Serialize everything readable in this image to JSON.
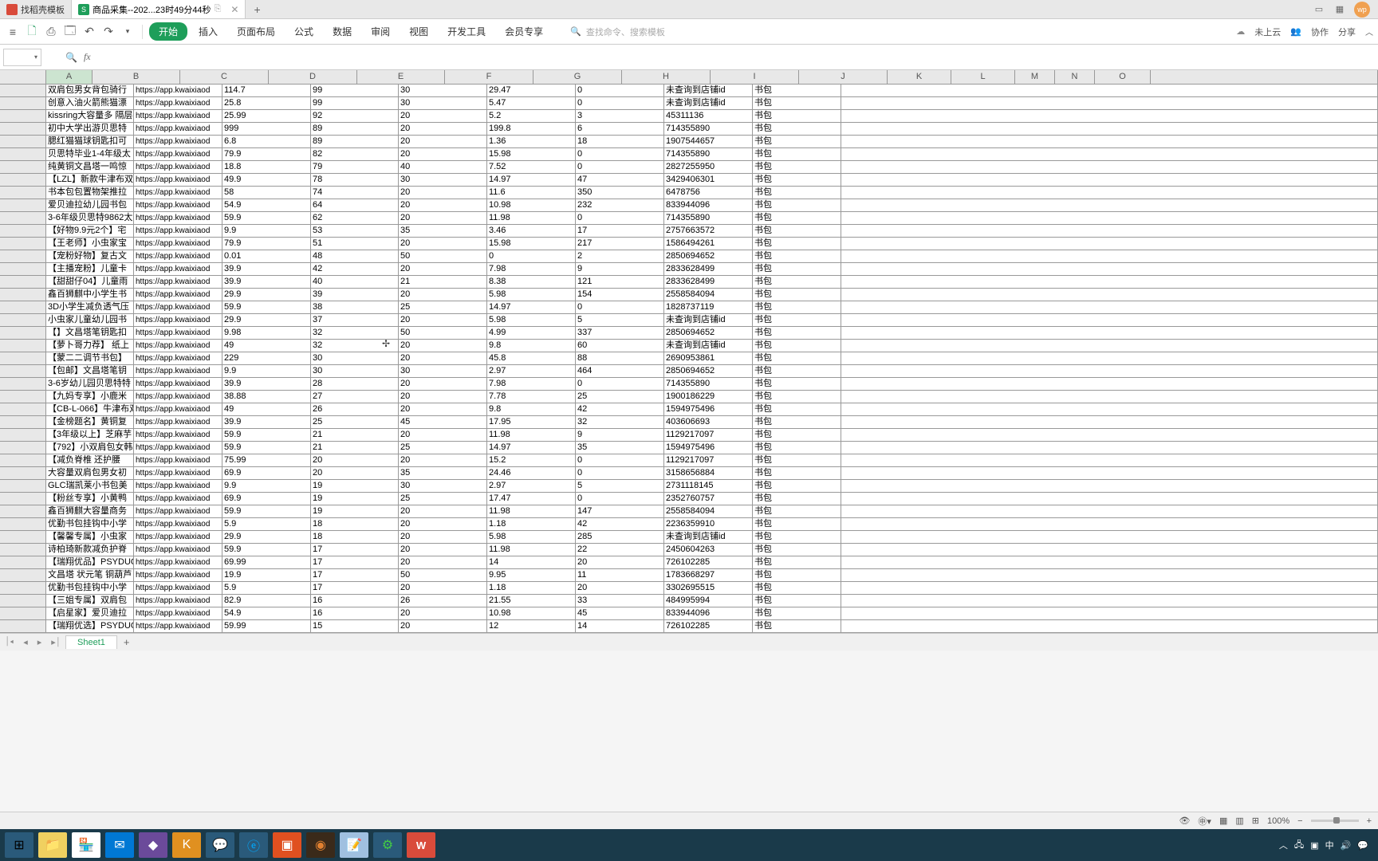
{
  "tabs": {
    "inactive": "找稻壳模板",
    "active": "商品采集--202...23时49分44秒",
    "active_suffix": "✕"
  },
  "titlebar_right": {
    "user": "wp"
  },
  "menu": {
    "start": "开始",
    "insert": "插入",
    "layout": "页面布局",
    "formula": "公式",
    "data": "数据",
    "review": "审阅",
    "view": "视图",
    "dev": "开发工具",
    "member": "会员专享"
  },
  "search_placeholder": "查找命令、搜索模板",
  "ribbon_right": {
    "cloud": "未上云",
    "collab": "协作",
    "share": "分享"
  },
  "formula": {
    "fx": "fx"
  },
  "columns": [
    "A",
    "B",
    "C",
    "D",
    "E",
    "F",
    "G",
    "H",
    "I",
    "J",
    "K",
    "L",
    "M",
    "N",
    "O"
  ],
  "col_widths": {
    "A": 58,
    "B": 110,
    "C": 111,
    "D": 111,
    "E": 110,
    "F": 111,
    "G": 111,
    "H": 111,
    "I": 111,
    "J": 111,
    "K": 80,
    "L": 80,
    "M": 50,
    "N": 50,
    "O": 70
  },
  "rows": [
    {
      "b": "双肩包男女背包骑行",
      "c": "https://app.kwaixiaod",
      "d": "114.7",
      "e": "99",
      "f": "30",
      "g": "29.47",
      "h": "0",
      "i": "未查询到店铺id",
      "j": "书包"
    },
    {
      "b": "创意入油火箭熊猫漂",
      "c": "https://app.kwaixiaod",
      "d": "25.8",
      "e": "99",
      "f": "30",
      "g": "5.47",
      "h": "0",
      "i": "未查询到店铺id",
      "j": "书包"
    },
    {
      "b": "kissring大容量多 隔层",
      "c": "https://app.kwaixiaod",
      "d": "25.99",
      "e": "92",
      "f": "20",
      "g": "5.2",
      "h": "3",
      "i": "45311136",
      "j": "书包"
    },
    {
      "b": "初中大学出游贝思特",
      "c": "https://app.kwaixiaod",
      "d": "999",
      "e": "89",
      "f": "20",
      "g": "199.8",
      "h": "6",
      "i": "714355890",
      "j": "书包"
    },
    {
      "b": "腮红猫猫球钥匙扣可",
      "c": "https://app.kwaixiaod",
      "d": "6.8",
      "e": "89",
      "f": "20",
      "g": "1.36",
      "h": "18",
      "i": "1907544657",
      "j": "书包"
    },
    {
      "b": "贝思特毕业1-4年级太",
      "c": "https://app.kwaixiaod",
      "d": "79.9",
      "e": "82",
      "f": "20",
      "g": "15.98",
      "h": "0",
      "i": "714355890",
      "j": "书包"
    },
    {
      "b": "纯黄铜文昌塔一鸣惊",
      "c": "https://app.kwaixiaod",
      "d": "18.8",
      "e": "79",
      "f": "40",
      "g": "7.52",
      "h": "0",
      "i": "2827255950",
      "j": "书包"
    },
    {
      "b": "【LZL】新款牛津布双",
      "c": "https://app.kwaixiaod",
      "d": "49.9",
      "e": "78",
      "f": "30",
      "g": "14.97",
      "h": "47",
      "i": "3429406301",
      "j": "书包"
    },
    {
      "b": "书本包包置物架推拉",
      "c": "https://app.kwaixiaod",
      "d": "58",
      "e": "74",
      "f": "20",
      "g": "11.6",
      "h": "350",
      "i": "6478756",
      "j": "书包"
    },
    {
      "b": "爱贝迪拉幼儿园书包",
      "c": "https://app.kwaixiaod",
      "d": "54.9",
      "e": "64",
      "f": "20",
      "g": "10.98",
      "h": "232",
      "i": "833944096",
      "j": "书包"
    },
    {
      "b": "3-6年级贝思特9862太",
      "c": "https://app.kwaixiaod",
      "d": "59.9",
      "e": "62",
      "f": "20",
      "g": "11.98",
      "h": "0",
      "i": "714355890",
      "j": "书包"
    },
    {
      "b": "【好物9.9元2个】宅",
      "c": "https://app.kwaixiaod",
      "d": "9.9",
      "e": "53",
      "f": "35",
      "g": "3.46",
      "h": "17",
      "i": "2757663572",
      "j": "书包"
    },
    {
      "b": "【王老师】小虫家宝",
      "c": "https://app.kwaixiaod",
      "d": "79.9",
      "e": "51",
      "f": "20",
      "g": "15.98",
      "h": "217",
      "i": "1586494261",
      "j": "书包"
    },
    {
      "b": "【宠粉好物】复古文",
      "c": "https://app.kwaixiaod",
      "d": "0.01",
      "e": "48",
      "f": "50",
      "g": "0",
      "h": "2",
      "i": "2850694652",
      "j": "书包"
    },
    {
      "b": "【主播宠粉】儿童卡",
      "c": "https://app.kwaixiaod",
      "d": "39.9",
      "e": "42",
      "f": "20",
      "g": "7.98",
      "h": "9",
      "i": "2833628499",
      "j": "书包"
    },
    {
      "b": "【甜甜仔04】儿童雨",
      "c": "https://app.kwaixiaod",
      "d": "39.9",
      "e": "40",
      "f": "21",
      "g": "8.38",
      "h": "121",
      "i": "2833628499",
      "j": "书包"
    },
    {
      "b": "鑫百狮麒中小学生书",
      "c": "https://app.kwaixiaod",
      "d": "29.9",
      "e": "39",
      "f": "20",
      "g": "5.98",
      "h": "154",
      "i": "2558584094",
      "j": "书包"
    },
    {
      "b": "3D小学生减负透气压",
      "c": "https://app.kwaixiaod",
      "d": "59.9",
      "e": "38",
      "f": "25",
      "g": "14.97",
      "h": "0",
      "i": "1828737119",
      "j": "书包"
    },
    {
      "b": "小虫家儿童幼儿园书",
      "c": "https://app.kwaixiaod",
      "d": "29.9",
      "e": "37",
      "f": "20",
      "g": "5.98",
      "h": "5",
      "i": "未查询到店铺id",
      "j": "书包"
    },
    {
      "b": "【】文昌塔笔钥匙扣",
      "c": "https://app.kwaixiaod",
      "d": "9.98",
      "e": "32",
      "f": "50",
      "g": "4.99",
      "h": "337",
      "i": "2850694652",
      "j": "书包"
    },
    {
      "b": "【萝卜哥力荐】 纸上",
      "c": "https://app.kwaixiaod",
      "d": "49",
      "e": "32",
      "f": "20",
      "g": "9.8",
      "h": "60",
      "i": "未查询到店铺id",
      "j": "书包"
    },
    {
      "b": "【蒙二二调节书包】",
      "c": "https://app.kwaixiaod",
      "d": "229",
      "e": "30",
      "f": "20",
      "g": "45.8",
      "h": "88",
      "i": "2690953861",
      "j": "书包"
    },
    {
      "b": "【包邮】文昌塔笔钥",
      "c": "https://app.kwaixiaod",
      "d": "9.9",
      "e": "30",
      "f": "30",
      "g": "2.97",
      "h": "464",
      "i": "2850694652",
      "j": "书包"
    },
    {
      "b": "3-6岁幼儿园贝思特特",
      "c": "https://app.kwaixiaod",
      "d": "39.9",
      "e": "28",
      "f": "20",
      "g": "7.98",
      "h": "0",
      "i": "714355890",
      "j": "书包"
    },
    {
      "b": "【九妈专享】小鹿米",
      "c": "https://app.kwaixiaod",
      "d": "38.88",
      "e": "27",
      "f": "20",
      "g": "7.78",
      "h": "25",
      "i": "1900186229",
      "j": "书包"
    },
    {
      "b": "【CB-L-066】牛津布双",
      "c": "https://app.kwaixiaod",
      "d": "49",
      "e": "26",
      "f": "20",
      "g": "9.8",
      "h": "42",
      "i": "1594975496",
      "j": "书包"
    },
    {
      "b": "【金榜题名】黄铜复",
      "c": "https://app.kwaixiaod",
      "d": "39.9",
      "e": "25",
      "f": "45",
      "g": "17.95",
      "h": "32",
      "i": "403606693",
      "j": "书包"
    },
    {
      "b": "【3年级以上】芝麻芋",
      "c": "https://app.kwaixiaod",
      "d": "59.9",
      "e": "21",
      "f": "20",
      "g": "11.98",
      "h": "9",
      "i": "1129217097",
      "j": "书包"
    },
    {
      "b": "【792】小双肩包女韩",
      "c": "https://app.kwaixiaod",
      "d": "59.9",
      "e": "21",
      "f": "25",
      "g": "14.97",
      "h": "35",
      "i": "1594975496",
      "j": "书包"
    },
    {
      "b": "【减负脊椎   还护腰",
      "c": "https://app.kwaixiaod",
      "d": "75.99",
      "e": "20",
      "f": "20",
      "g": "15.2",
      "h": "0",
      "i": "1129217097",
      "j": "书包"
    },
    {
      "b": "大容量双肩包男女初",
      "c": "https://app.kwaixiaod",
      "d": "69.9",
      "e": "20",
      "f": "35",
      "g": "24.46",
      "h": "0",
      "i": "3158656884",
      "j": "书包"
    },
    {
      "b": "GLC瑞凯莱小书包美",
      "c": "https://app.kwaixiaod",
      "d": "9.9",
      "e": "19",
      "f": "30",
      "g": "2.97",
      "h": "5",
      "i": "2731118145",
      "j": "书包"
    },
    {
      "b": "【粉丝专享】小黄鸭",
      "c": "https://app.kwaixiaod",
      "d": "69.9",
      "e": "19",
      "f": "25",
      "g": "17.47",
      "h": "0",
      "i": "2352760757",
      "j": "书包"
    },
    {
      "b": "鑫百狮麒大容量商务",
      "c": "https://app.kwaixiaod",
      "d": "59.9",
      "e": "19",
      "f": "20",
      "g": "11.98",
      "h": "147",
      "i": "2558584094",
      "j": "书包"
    },
    {
      "b": "优勤书包挂钩中小学",
      "c": "https://app.kwaixiaod",
      "d": "5.9",
      "e": "18",
      "f": "20",
      "g": "1.18",
      "h": "42",
      "i": "2236359910",
      "j": "书包"
    },
    {
      "b": "【馨馨专属】小虫家",
      "c": "https://app.kwaixiaod",
      "d": "29.9",
      "e": "18",
      "f": "20",
      "g": "5.98",
      "h": "285",
      "i": "未查询到店铺id",
      "j": "书包"
    },
    {
      "b": "诗柏琦新款减负护脊",
      "c": "https://app.kwaixiaod",
      "d": "59.9",
      "e": "17",
      "f": "20",
      "g": "11.98",
      "h": "22",
      "i": "2450604263",
      "j": "书包"
    },
    {
      "b": "【瑞翔优品】PSYDUC",
      "c": "https://app.kwaixiaod",
      "d": "69.99",
      "e": "17",
      "f": "20",
      "g": "14",
      "h": "20",
      "i": "726102285",
      "j": "书包"
    },
    {
      "b": "文昌塔 状元笔 铜葫芦",
      "c": "https://app.kwaixiaod",
      "d": "19.9",
      "e": "17",
      "f": "50",
      "g": "9.95",
      "h": "11",
      "i": "1783668297",
      "j": "书包"
    },
    {
      "b": "优勤书包挂钩中小学",
      "c": "https://app.kwaixiaod",
      "d": "5.9",
      "e": "17",
      "f": "20",
      "g": "1.18",
      "h": "20",
      "i": "3302695515",
      "j": "书包"
    },
    {
      "b": "【三姐专属】双肩包",
      "c": "https://app.kwaixiaod",
      "d": "82.9",
      "e": "16",
      "f": "26",
      "g": "21.55",
      "h": "33",
      "i": "484995994",
      "j": "书包"
    },
    {
      "b": "【启星家】爱贝迪拉",
      "c": "https://app.kwaixiaod",
      "d": "54.9",
      "e": "16",
      "f": "20",
      "g": "10.98",
      "h": "45",
      "i": "833944096",
      "j": "书包"
    },
    {
      "b": "【瑞翔优选】PSYDUC",
      "c": "https://app.kwaixiaod",
      "d": "59.99",
      "e": "15",
      "f": "20",
      "g": "12",
      "h": "14",
      "i": "726102285",
      "j": "书包"
    }
  ],
  "sheet": {
    "name": "Sheet1"
  },
  "status": {
    "zoom": "100%"
  },
  "taskbar": {
    "time": "",
    "date": ""
  }
}
